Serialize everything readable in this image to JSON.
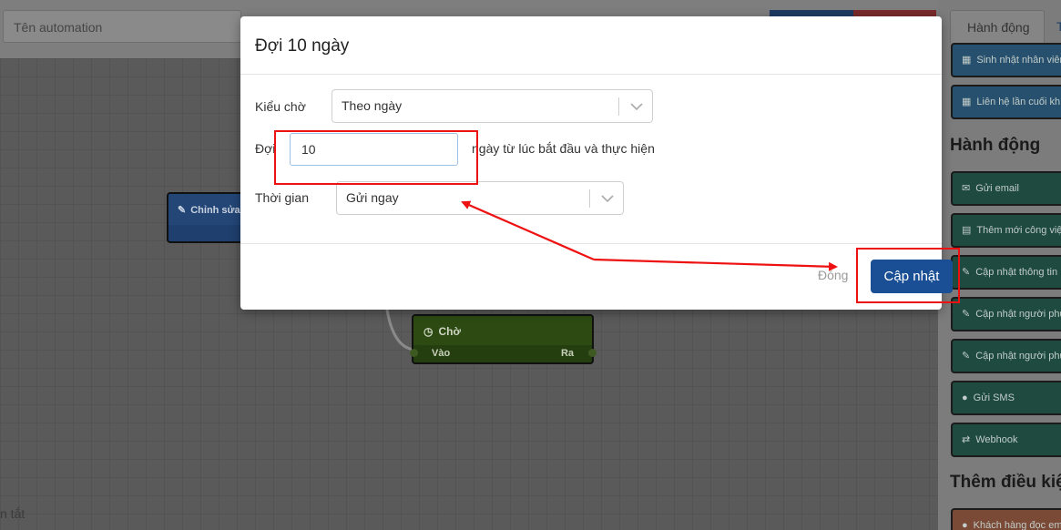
{
  "app": {
    "name_placeholder": "Tên automation",
    "bottom_text": "n tắt"
  },
  "canvas": {
    "edit_node": {
      "label": "Chỉnh sửa",
      "icon": "edit-icon"
    },
    "wait_node": {
      "label": "Chờ",
      "in_label": "Vào",
      "out_label": "Ra",
      "icon": "clock-icon"
    }
  },
  "sidebar": {
    "tabs": [
      "Hành động",
      "T"
    ],
    "trigger_items": [
      {
        "label": "Sinh nhật nhân viên",
        "icon": "calendar-icon"
      },
      {
        "label": "Liên hệ lần cuối kh",
        "icon": "calendar-icon"
      }
    ],
    "actions_heading": "Hành động",
    "action_items": [
      {
        "label": "Gửi email",
        "icon": "envelope-icon"
      },
      {
        "label": "Thêm mới công việc",
        "icon": "task-icon"
      },
      {
        "label": "Cập nhật thông tin",
        "icon": "edit-icon"
      },
      {
        "label": "Cập nhật người phụ",
        "icon": "edit-icon"
      },
      {
        "label": "Cập nhật người phụ",
        "icon": "edit-icon"
      },
      {
        "label": "Gửi SMS",
        "icon": "chat-icon"
      },
      {
        "label": "Webhook",
        "icon": "retweet-icon"
      }
    ],
    "conditions_heading": "Thêm điều kiện",
    "condition_items": [
      {
        "label": "Khách hàng đọc email",
        "icon": "user-icon"
      }
    ]
  },
  "modal": {
    "title": "Đợi 10 ngày",
    "wait_type_label": "Kiểu chờ",
    "wait_type_value": "Theo ngày",
    "wait_label": "Đợi",
    "wait_days": "10",
    "wait_suffix": "ngày từ lúc bắt đầu và thực hiện",
    "time_label": "Thời gian",
    "time_value": "Gửi ngay",
    "close_label": "Đóng",
    "update_label": "Cập nhật"
  },
  "colors": {
    "accent": "#1b4f95",
    "annotation": "#ee1111"
  }
}
